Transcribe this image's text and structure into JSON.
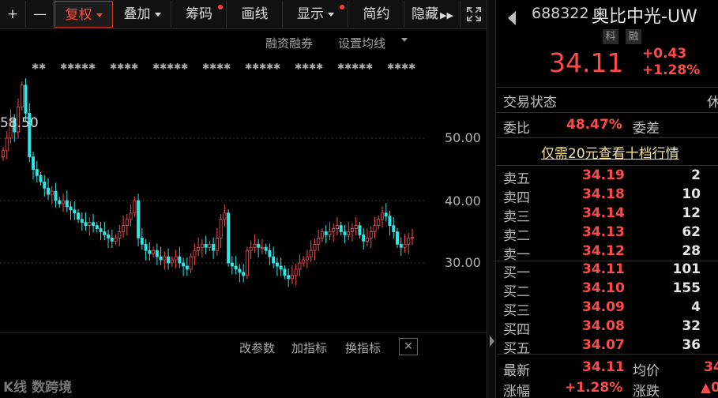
{
  "toolbar": {
    "plus": "+",
    "minus": "—",
    "fuquan": "复权",
    "diejia": "叠加",
    "chouma": "筹码",
    "xianlu": "画线",
    "xianshi": "显示",
    "jianyue": "简约",
    "yincang": "隐藏"
  },
  "chart": {
    "link_margin": "融资融券",
    "link_ma": "设置均线",
    "price_max_label": "58.50",
    "y_ticks": [
      "50.00",
      "40.00",
      "30.00"
    ],
    "bottom_links": [
      "改参数",
      "加指标",
      "换指标"
    ],
    "close": "✕",
    "watermark": "K线 数跨境"
  },
  "chart_data": {
    "type": "candlestick",
    "y_axis_ticks": [
      50,
      40,
      30
    ],
    "max_label": 58.5,
    "closes": [
      48,
      50,
      53,
      51,
      55,
      58.5,
      54,
      47,
      45,
      44,
      43,
      42,
      41,
      41.5,
      40,
      39.5,
      40,
      39,
      38.5,
      38,
      37,
      36.5,
      36,
      36.5,
      36,
      35.5,
      35,
      34.5,
      34,
      33.5,
      34,
      35,
      36,
      37,
      38,
      40,
      34,
      33,
      32,
      31.5,
      32,
      31,
      30.5,
      31,
      30,
      30.5,
      31,
      30,
      29.5,
      29,
      31,
      32,
      32.5,
      33,
      32.5,
      33,
      32,
      34,
      37,
      38,
      30,
      29.5,
      29,
      28.5,
      28,
      32,
      32.5,
      33,
      32.5,
      32.5,
      32,
      31,
      30,
      29.5,
      29,
      28,
      27.5,
      28,
      29,
      30,
      30.5,
      31,
      32,
      33,
      34,
      35,
      34.5,
      35,
      35.5,
      36,
      35,
      34.5,
      35,
      35.5,
      36,
      34.5,
      33.5,
      34,
      35,
      36,
      37,
      38,
      37.5,
      36,
      35,
      33,
      32.5,
      33,
      34,
      34.11
    ],
    "marker_row": true
  },
  "quote": {
    "code": "688322",
    "name": "奥比中光-UW",
    "tag1": "科",
    "tag2": "融",
    "price": "34.11",
    "change": "+0.43",
    "change_pct": "+1.28%",
    "trade_status_label": "交易状态",
    "trade_status_value": "休",
    "weibi_label": "委比",
    "weibi_value": "48.47%",
    "weicha_label": "委差",
    "promo": "仅需20元查看十档行情"
  },
  "order_book": {
    "asks": [
      {
        "label": "卖五",
        "price": "34.19",
        "vol": "2"
      },
      {
        "label": "卖四",
        "price": "34.18",
        "vol": "10"
      },
      {
        "label": "卖三",
        "price": "34.14",
        "vol": "12"
      },
      {
        "label": "卖二",
        "price": "34.13",
        "vol": "62"
      },
      {
        "label": "卖一",
        "price": "34.12",
        "vol": "28"
      }
    ],
    "bids": [
      {
        "label": "买一",
        "price": "34.11",
        "vol": "101"
      },
      {
        "label": "买二",
        "price": "34.10",
        "vol": "155"
      },
      {
        "label": "买三",
        "price": "34.09",
        "vol": "4"
      },
      {
        "label": "买四",
        "price": "34.08",
        "vol": "32"
      },
      {
        "label": "买五",
        "price": "34.07",
        "vol": "36"
      }
    ]
  },
  "stats": {
    "latest_label": "最新",
    "latest_value": "34.11",
    "avg_label": "均价",
    "avg_value": "34",
    "chg_pct_label": "涨幅",
    "chg_pct_value": "+1.28%",
    "chg_label": "涨跌",
    "chg_value": "▲0"
  },
  "colors": {
    "up": "#ff4a4a",
    "down": "#2ee6e6",
    "accent": "#d13a2a"
  }
}
